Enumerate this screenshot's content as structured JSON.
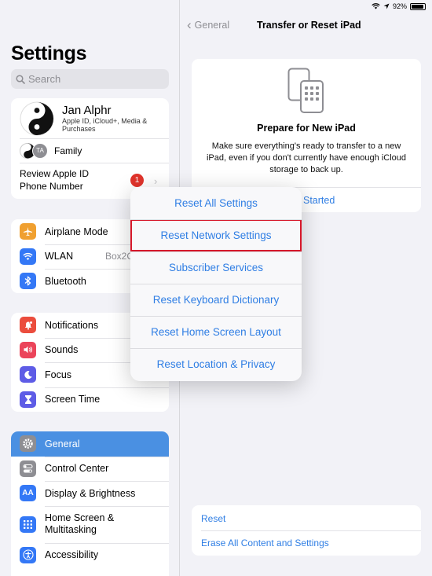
{
  "status_bar": {
    "battery": "92%",
    "battery_level": 0.92
  },
  "sidebar": {
    "title": "Settings",
    "search_placeholder": "Search",
    "account": {
      "name": "Jan Alphr",
      "subtitle": "Apple ID, iCloud+, Media & Purchases",
      "family_initials": "TA",
      "family_label": "Family",
      "review_line1": "Review Apple ID",
      "review_line2": "Phone Number",
      "review_badge": "1"
    },
    "connectivity": [
      {
        "label": "Airplane Mode",
        "icon": "airplane-icon",
        "color": "#f0a030"
      },
      {
        "label": "WLAN",
        "icon": "wifi-icon",
        "color": "#3478f6",
        "value": "Box2C"
      },
      {
        "label": "Bluetooth",
        "icon": "bluetooth-icon",
        "color": "#3478f6"
      }
    ],
    "notifications": [
      {
        "label": "Notifications",
        "icon": "bell-icon",
        "color": "#eb4d3d"
      },
      {
        "label": "Sounds",
        "icon": "speaker-icon",
        "color": "#eb445a"
      },
      {
        "label": "Focus",
        "icon": "moon-icon",
        "color": "#5e5ce6"
      },
      {
        "label": "Screen Time",
        "icon": "hourglass-icon",
        "color": "#5e5ce6"
      }
    ],
    "general": [
      {
        "label": "General",
        "icon": "gear-icon",
        "color": "#8e8e93",
        "selected": true
      },
      {
        "label": "Control Center",
        "icon": "toggles-icon",
        "color": "#8e8e93"
      },
      {
        "label": "Display & Brightness",
        "icon": "text-size-icon",
        "color": "#3478f6"
      },
      {
        "label": "Home Screen &",
        "label2": "Multitasking",
        "icon": "grid-icon",
        "color": "#3478f6"
      },
      {
        "label": "Accessibility",
        "icon": "accessibility-icon",
        "color": "#3478f6"
      }
    ]
  },
  "detail": {
    "back_label": "General",
    "title": "Transfer or Reset iPad",
    "prepare_title": "Prepare for New iPad",
    "prepare_desc": "Make sure everything's ready to transfer to a new iPad, even if you don't currently have enough iCloud storage to back up.",
    "get_started_visible": "Started",
    "reset_label": "Reset",
    "erase_label": "Erase All Content and Settings"
  },
  "menu": {
    "items": [
      "Reset All Settings",
      "Reset Network Settings",
      "Subscriber Services",
      "Reset Keyboard Dictionary",
      "Reset Home Screen Layout",
      "Reset Location & Privacy"
    ],
    "highlighted_index": 1,
    "highlight_color": "#d6172a"
  },
  "colors": {
    "accent": "#2f7ee4",
    "selected_row": "#4a90e2",
    "badge": "#e0332b"
  }
}
